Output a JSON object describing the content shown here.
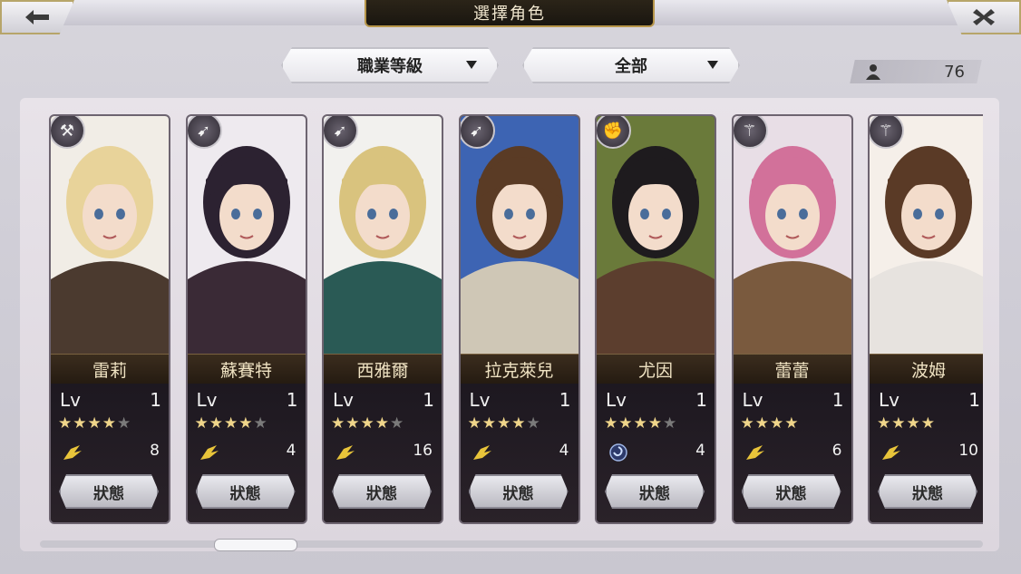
{
  "title": "選擇角色",
  "header": {
    "back_icon": "arrow-left-icon",
    "close_icon": "close-x-icon"
  },
  "filters": {
    "sort_label": "職業等級",
    "category_label": "全部"
  },
  "owned_count": "76",
  "colors": {
    "accent_gold": "#b7964a",
    "star_on": "#efd58a",
    "star_off": "#7a7a7a"
  },
  "characters": [
    {
      "name": "雷莉",
      "lv_label": "Lv",
      "level": "1",
      "stars": 4,
      "max_stars": 5,
      "class_icon": "wing-icon",
      "class_count": "8",
      "status_label": "狀態",
      "weapon_icon": "axe-icon",
      "hair": "#e8d39a",
      "outfit": "#4b3a2f",
      "bg": "#f1ede6"
    },
    {
      "name": "蘇賽特",
      "lv_label": "Lv",
      "level": "1",
      "stars": 4,
      "max_stars": 5,
      "class_icon": "wing-icon",
      "class_count": "4",
      "status_label": "狀態",
      "weapon_icon": "bow-icon",
      "hair": "#2c2231",
      "outfit": "#3a2a36",
      "bg": "#eeeaef"
    },
    {
      "name": "西雅爾",
      "lv_label": "Lv",
      "level": "1",
      "stars": 4,
      "max_stars": 5,
      "class_icon": "wing-icon",
      "class_count": "16",
      "status_label": "狀態",
      "weapon_icon": "bow-icon",
      "hair": "#d9c37e",
      "outfit": "#2a5a55",
      "bg": "#f2f1ee"
    },
    {
      "name": "拉克萊兒",
      "lv_label": "Lv",
      "level": "1",
      "stars": 4,
      "max_stars": 5,
      "class_icon": "wing-icon",
      "class_count": "4",
      "status_label": "狀態",
      "weapon_icon": "bow-icon",
      "hair": "#5a3b25",
      "outfit": "#cfc7b6",
      "bg": "#3d64b3"
    },
    {
      "name": "尤因",
      "lv_label": "Lv",
      "level": "1",
      "stars": 4,
      "max_stars": 5,
      "class_icon": "swirl-icon",
      "class_count": "4",
      "status_label": "狀態",
      "weapon_icon": "gauntlet-icon",
      "hair": "#1e1b1e",
      "outfit": "#5c3e2e",
      "bg": "#6a7a3a"
    },
    {
      "name": "蕾蕾",
      "lv_label": "Lv",
      "level": "1",
      "stars": 4,
      "max_stars": 4,
      "class_icon": "wing-icon",
      "class_count": "6",
      "status_label": "狀態",
      "weapon_icon": "staff-icon",
      "hair": "#d2719a",
      "outfit": "#7a5a3e",
      "bg": "#e8dee6"
    },
    {
      "name": "波姆",
      "lv_label": "Lv",
      "level": "1",
      "stars": 4,
      "max_stars": 4,
      "class_icon": "wing-icon",
      "class_count": "10",
      "status_label": "狀態",
      "weapon_icon": "staff-icon",
      "hair": "#5a3a26",
      "outfit": "#e7e3df",
      "bg": "#f5efe9"
    }
  ]
}
